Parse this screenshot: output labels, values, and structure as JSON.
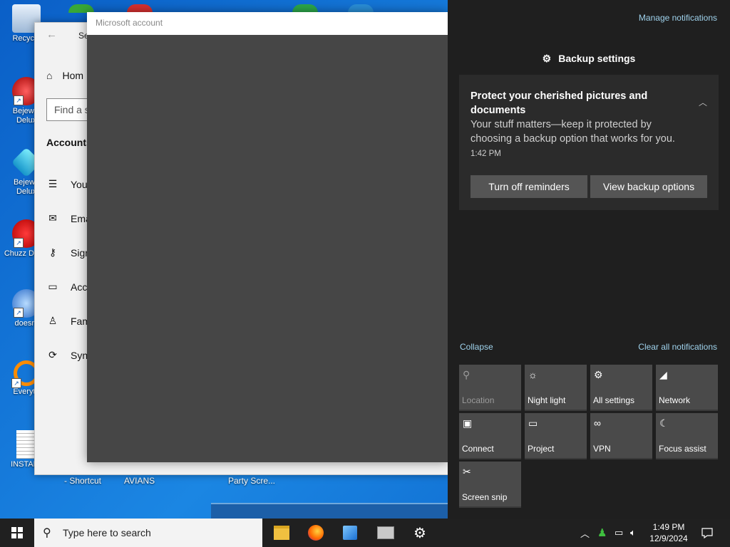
{
  "desktop": {
    "icons": [
      {
        "label": "Recycle"
      },
      {
        "label": "Bejewel Delux"
      },
      {
        "label": "Bejewe Delux"
      },
      {
        "label": "Chuzz Delux"
      },
      {
        "label": "doesnt"
      },
      {
        "label": "Everyth"
      },
      {
        "label": "INSTALL"
      }
    ],
    "captions": [
      "- Shortcut",
      "AVIANS",
      "Party Scre..."
    ]
  },
  "settings_window": {
    "title": "Se",
    "home_label": "Hom",
    "search_placeholder": "Find a s",
    "section_heading": "Accounts",
    "nav_items": [
      {
        "label": "Your",
        "icon": "user-info-icon"
      },
      {
        "label": "Ema",
        "icon": "mail-icon"
      },
      {
        "label": "Sign",
        "icon": "key-icon"
      },
      {
        "label": "Acce",
        "icon": "briefcase-icon"
      },
      {
        "label": "Fam",
        "icon": "family-icon"
      },
      {
        "label": "Sync",
        "icon": "sync-icon"
      }
    ]
  },
  "ms_dialog": {
    "title": "Microsoft account"
  },
  "action_center": {
    "manage_label": "Manage notifications",
    "group_header": "Backup settings",
    "notification": {
      "title": "Protect your cherished pictures and documents",
      "body": "Your stuff matters—keep it protected by choosing a backup option that works for you.",
      "time": "1:42 PM",
      "button_1": "Turn off reminders",
      "button_2": "View backup options"
    },
    "collapse_label": "Collapse",
    "clear_label": "Clear all notifications",
    "quick_actions": [
      {
        "label": "Location",
        "icon": "location-icon",
        "glyph": "⚲",
        "disabled": true
      },
      {
        "label": "Night light",
        "icon": "night-light-icon",
        "glyph": "☼"
      },
      {
        "label": "All settings",
        "icon": "gear-icon",
        "glyph": "⚙"
      },
      {
        "label": "Network",
        "icon": "network-icon",
        "glyph": "◢"
      },
      {
        "label": "Connect",
        "icon": "connect-icon",
        "glyph": "▣"
      },
      {
        "label": "Project",
        "icon": "project-icon",
        "glyph": "▭"
      },
      {
        "label": "VPN",
        "icon": "vpn-icon",
        "glyph": "∞"
      },
      {
        "label": "Focus assist",
        "icon": "moon-icon",
        "glyph": "☾"
      },
      {
        "label": "Screen snip",
        "icon": "screen-snip-icon",
        "glyph": "✂"
      }
    ]
  },
  "taskbar": {
    "search_placeholder": "Type here to search",
    "time": "1:49 PM",
    "date": "12/9/2024"
  }
}
